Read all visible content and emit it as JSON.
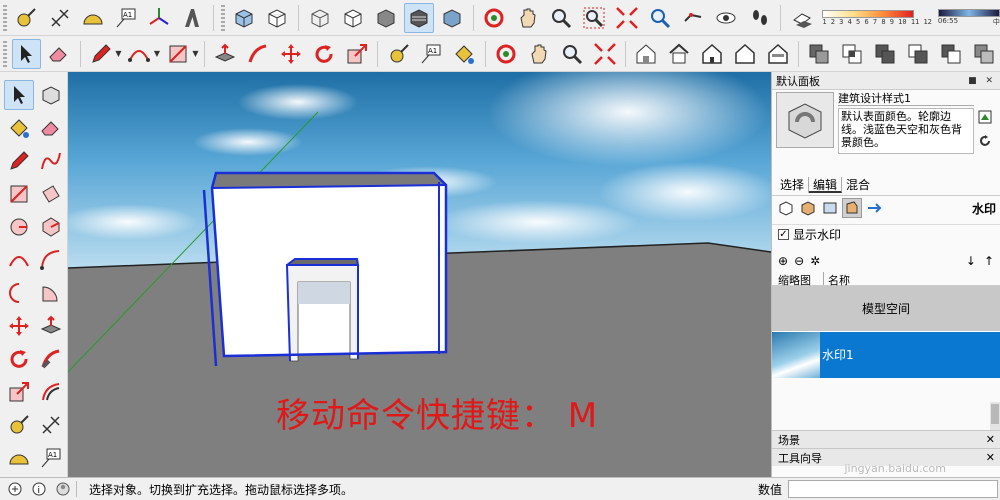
{
  "toolbar": {
    "legend_numbers": "1 2 3 4 5 6 7 8 9 10 11 12",
    "time_start": "06:55",
    "time_mid": "中",
    "icons_row1": [
      "tape-measure-icon",
      "dimension-icon",
      "protractor-icon",
      "text-label-icon",
      "axes-icon",
      "3d-text-icon",
      "front-iso-view-icon",
      "wireframe-box-icon",
      "hidden-line-icon",
      "shaded-icon",
      "shaded-texture-icon",
      "monochrome-icon",
      "orbit-icon",
      "pan-icon",
      "zoom-icon",
      "zoom-window-icon",
      "zoom-extents-icon",
      "previous-view-icon",
      "look-around-icon",
      "walk-icon",
      "shadow-icon"
    ],
    "icons_row2": [
      "select-arrow-icon",
      "eraser-icon",
      "pencil-icon",
      "arc-icon",
      "rectangle-icon",
      "push-pull-icon",
      "follow-me-icon",
      "move-icon",
      "rotate-icon",
      "scale-icon",
      "tape-measure-icon",
      "text-icon",
      "paint-bucket-icon",
      "orbit-icon",
      "pan-icon",
      "zoom-icon",
      "zoom-extents-icon",
      "iso-view-icon",
      "top-view-icon",
      "front-view-icon",
      "right-view-icon",
      "back-view-icon",
      "left-view-icon",
      "outer-shell-icon",
      "intersect-icon",
      "union-icon",
      "subtract-icon",
      "trim-icon",
      "split-icon"
    ]
  },
  "tray": {
    "title": "默认面板",
    "style_name": "建筑设计样式1",
    "style_description": "默认表面颜色。轮廓边线。浅蓝色天空和灰色背景颜色。",
    "tabs": [
      "选择",
      "编辑",
      "混合"
    ],
    "selected_tab": "编辑",
    "edit_section_label": "水印",
    "show_watermark_label": "显示水印",
    "show_watermark_checked": true,
    "column_thumb": "缩略图",
    "column_name": "名称",
    "items": [
      {
        "name": "模型空间",
        "active": false
      },
      {
        "name": "水印1",
        "active": true
      }
    ],
    "collapsed_panels": [
      "场景",
      "工具向导"
    ]
  },
  "viewport": {
    "caption": "移动命令快捷键： M"
  },
  "statusbar": {
    "message": "选择对象。切换到扩充选择。拖动鼠标选择多项。",
    "value_label": "数值",
    "value": ""
  },
  "watermark": "jingyan.baidu.com",
  "colors": {
    "caption": "#e01818",
    "selection_edge": "#1a2fd6",
    "active_item": "#0a78d0",
    "ground": "#7f7f7f"
  }
}
